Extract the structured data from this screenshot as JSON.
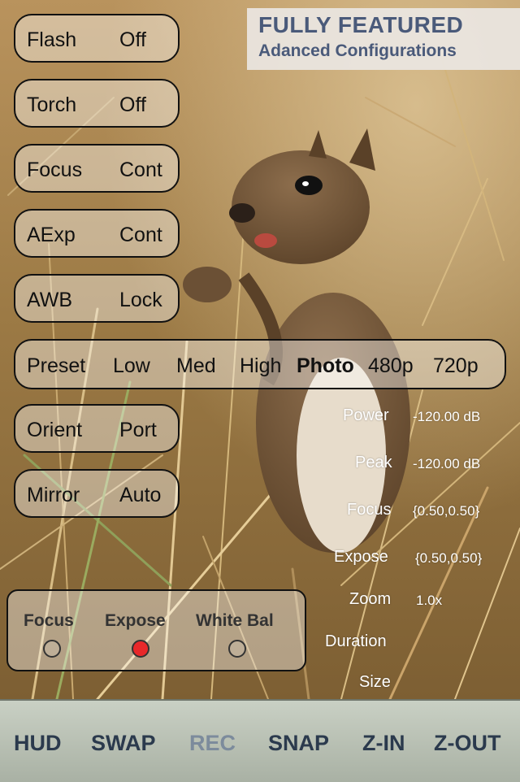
{
  "banner": {
    "title": "FULLY FEATURED",
    "subtitle": "Adanced Configurations"
  },
  "settings": [
    {
      "label": "Flash",
      "value": "Off"
    },
    {
      "label": "Torch",
      "value": "Off"
    },
    {
      "label": "Focus",
      "value": "Cont"
    },
    {
      "label": "AExp",
      "value": "Cont"
    },
    {
      "label": "AWB",
      "value": "Lock"
    },
    {
      "label": "Orient",
      "value": "Port"
    },
    {
      "label": "Mirror",
      "value": "Auto"
    }
  ],
  "preset": {
    "label": "Preset",
    "options": [
      "Low",
      "Med",
      "High",
      "Photo",
      "480p",
      "720p"
    ],
    "selected": "Photo"
  },
  "stats": {
    "power": {
      "label": "Power",
      "value": "-120.00 dB"
    },
    "peak": {
      "label": "Peak",
      "value": "-120.00 dB"
    },
    "focus": {
      "label": "Focus",
      "value": "{0.50,0.50}"
    },
    "expose": {
      "label": "Expose",
      "value": "{0.50,0.50}"
    },
    "zoom": {
      "label": "Zoom",
      "value": "1.0x"
    },
    "duration": {
      "label": "Duration",
      "value": ""
    },
    "size": {
      "label": "Size",
      "value": ""
    }
  },
  "tap_mode": {
    "options": [
      "Focus",
      "Expose",
      "White Bal"
    ],
    "selected": "Expose",
    "selected_color": "#e8282a"
  },
  "toolbar": {
    "buttons": [
      {
        "label": "HUD",
        "enabled": true
      },
      {
        "label": "SWAP",
        "enabled": true
      },
      {
        "label": "REC",
        "enabled": false
      },
      {
        "label": "SNAP",
        "enabled": true
      },
      {
        "label": "Z-IN",
        "enabled": true
      },
      {
        "label": "Z-OUT",
        "enabled": true
      }
    ]
  }
}
